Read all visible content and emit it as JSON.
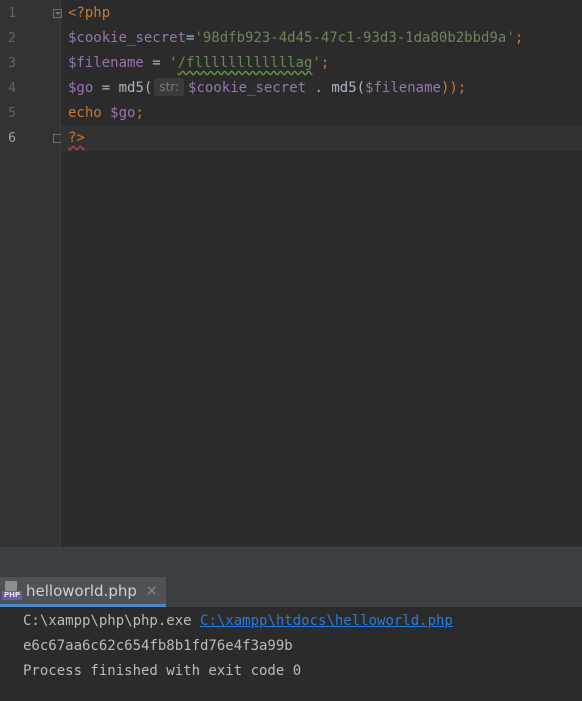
{
  "editor": {
    "line_numbers": [
      "1",
      "2",
      "3",
      "4",
      "5",
      "6"
    ],
    "lines": {
      "l1": {
        "open_tag": "<?php"
      },
      "l2": {
        "var": "$cookie_secret",
        "eq": "=",
        "str": "'98dfb923-4d45-47c1-93d3-1da80b2bbd9a'",
        "semi": ";"
      },
      "l3": {
        "var": "$filename",
        "eq": " = ",
        "q1": "'",
        "path": "/fllllllllllllag",
        "q2": "'",
        "semi": ";"
      },
      "l4": {
        "var": "$go",
        "eq": " = ",
        "fn": "md5(",
        "hint": "str:",
        "arg_var": "$cookie_secret",
        "concat": " . ",
        "fn2": "md5(",
        "arg_var2": "$filename",
        "close": "));"
      },
      "l5": {
        "kw": "echo ",
        "var": "$go",
        "semi": ";"
      },
      "l6": {
        "close_tag": "?>"
      }
    }
  },
  "run_panel": {
    "tab_label": "helloworld.php",
    "tab_close": "×",
    "php_badge": "PHP",
    "console": {
      "command_prefix": "C:\\xampp\\php\\php.exe ",
      "command_link": "C:\\xampp\\htdocs\\helloworld.php",
      "output": "e6c67aa6c62c654fb8b1fd76e4f3a99b",
      "exit_message": "Process finished with exit code 0"
    }
  },
  "colors": {
    "keyword": "#cc7832",
    "variable": "#9876aa",
    "string": "#6a8759",
    "link": "#287bde",
    "background": "#2b2b2b"
  }
}
